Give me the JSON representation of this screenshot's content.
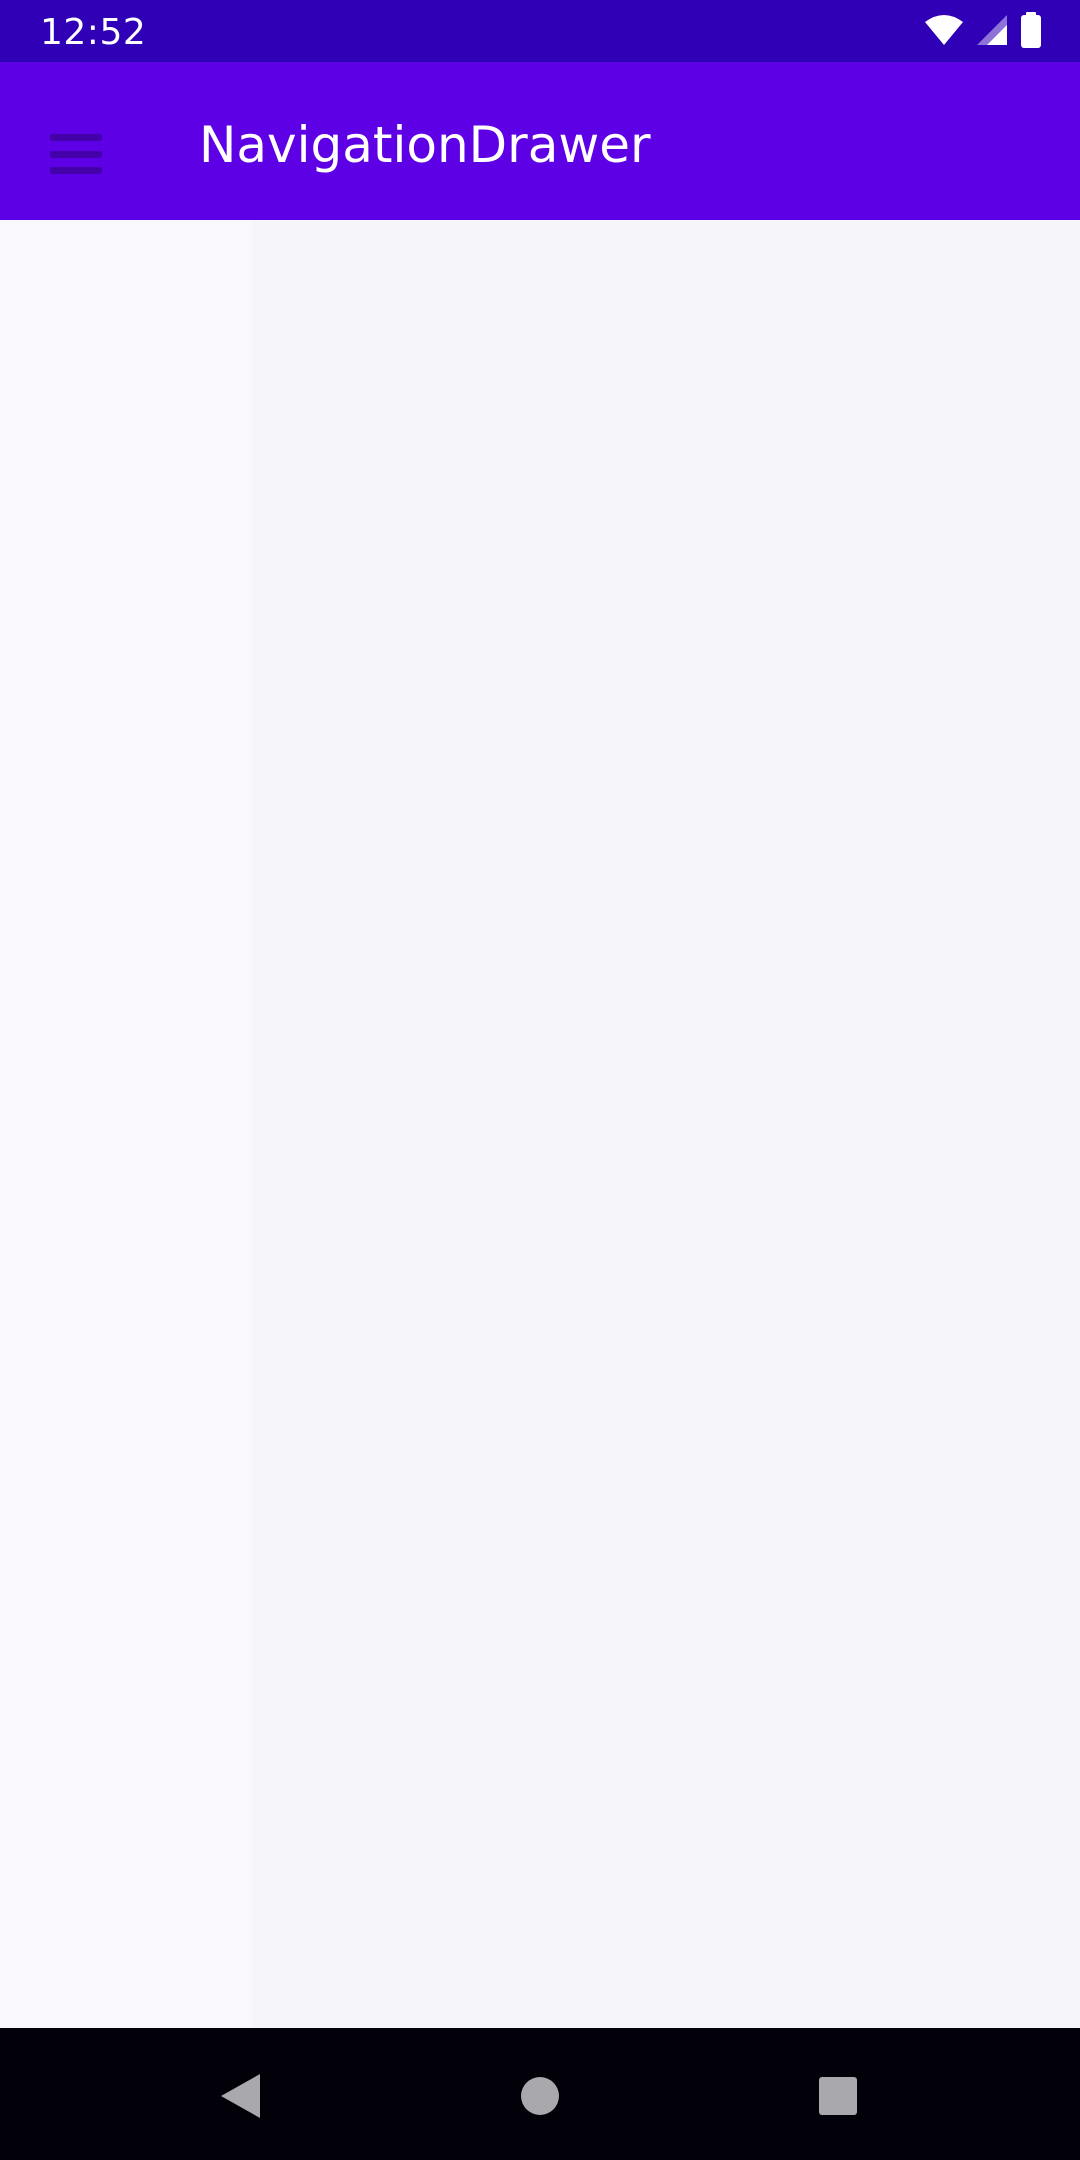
{
  "status_bar": {
    "time": "12:52",
    "icons": [
      "wifi-icon",
      "signal-icon",
      "battery-icon"
    ]
  },
  "app_bar": {
    "title": "NavigationDrawer",
    "menu_icon": "hamburger-menu-icon"
  },
  "nav_bar": {
    "buttons": [
      "back-icon",
      "home-icon",
      "recents-icon"
    ]
  },
  "colors": {
    "status_bar_bg": "#3000b6",
    "app_bar_bg": "#5e00e6",
    "content_bg": "#f6f5fa",
    "nav_bar_bg": "#020008"
  }
}
